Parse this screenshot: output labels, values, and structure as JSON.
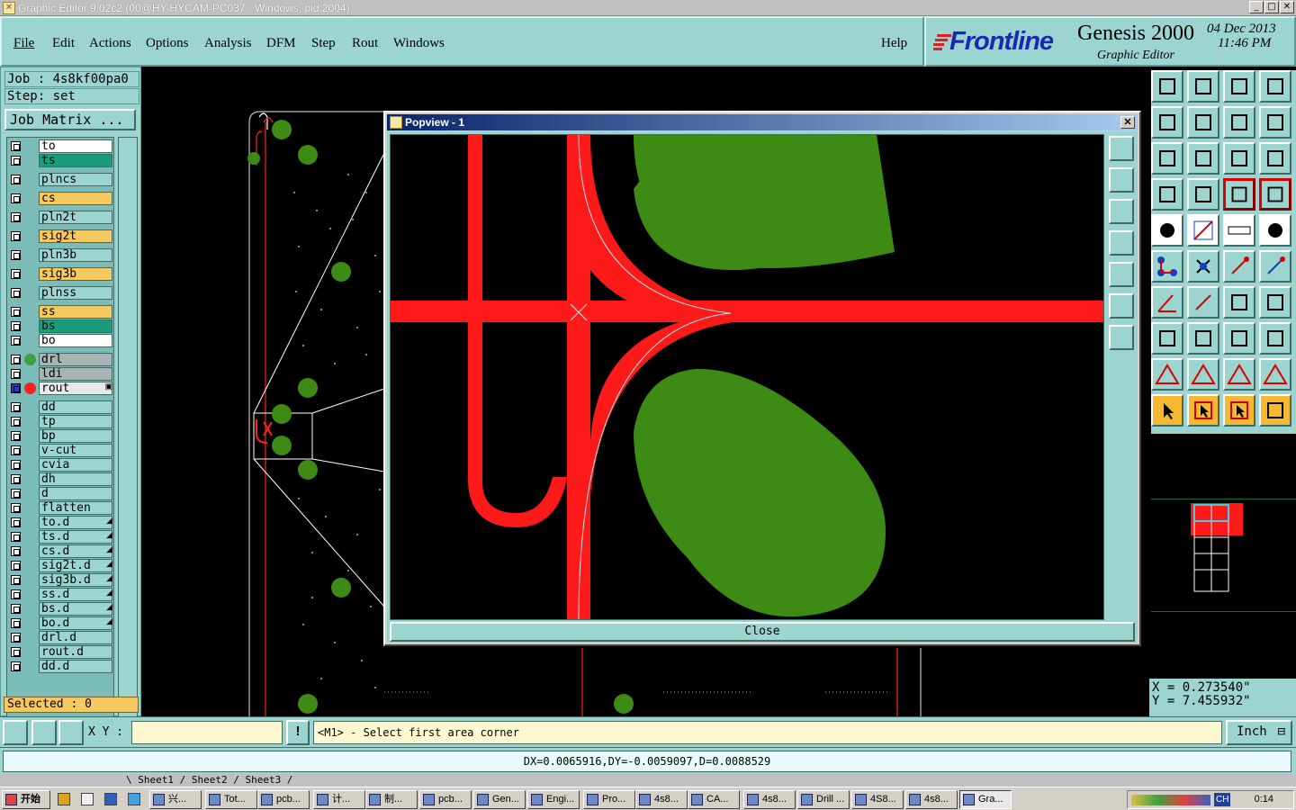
{
  "window": {
    "title": "Graphic Editor 9.02c2 (00@HY-HYCAM-PC037 - Windows, pid:2004)",
    "minimize": "_",
    "maximize": "□",
    "close": "✕"
  },
  "menu": {
    "items": [
      "File",
      "Edit",
      "Actions",
      "Options",
      "Analysis",
      "DFM",
      "Step",
      "Rout",
      "Windows"
    ],
    "help": "Help"
  },
  "brand": {
    "logo": "Frontline",
    "product": "Genesis 2000",
    "subtitle": "Graphic Editor",
    "date": "04 Dec 2013",
    "time": "11:46 PM"
  },
  "job": {
    "job_line": "Job : 4s8kf00pa0",
    "step_line": "Step: set",
    "matrix_button": "Job Matrix ..."
  },
  "layers": [
    {
      "name": "to",
      "color": "#ffffff"
    },
    {
      "name": "ts",
      "color": "#1a9c78"
    },
    {
      "name": "plncs",
      "color": "#9cd4d0"
    },
    {
      "name": "cs",
      "color": "#f5c860"
    },
    {
      "name": "pln2t",
      "color": "#9cd4d0"
    },
    {
      "name": "sig2t",
      "color": "#f5c860"
    },
    {
      "name": "pln3b",
      "color": "#9cd4d0"
    },
    {
      "name": "sig3b",
      "color": "#f5c860"
    },
    {
      "name": "plnss",
      "color": "#9cd4d0"
    },
    {
      "name": "ss",
      "color": "#f5c860"
    },
    {
      "name": "bs",
      "color": "#1a9c78"
    },
    {
      "name": "bo",
      "color": "#ffffff"
    },
    {
      "name": "drl",
      "color": "#a8b4b4",
      "dot": "#40a040"
    },
    {
      "name": "ldi",
      "color": "#a8b4b4"
    },
    {
      "name": "rout",
      "color": "#e8e8e8",
      "dot": "#ff2020",
      "active": true
    },
    {
      "name": "dd",
      "color": "#9cd4d0"
    },
    {
      "name": "tp",
      "color": "#9cd4d0"
    },
    {
      "name": "bp",
      "color": "#9cd4d0"
    },
    {
      "name": "v-cut",
      "color": "#9cd4d0"
    },
    {
      "name": "cvia",
      "color": "#9cd4d0"
    },
    {
      "name": "dh",
      "color": "#9cd4d0"
    },
    {
      "name": "d",
      "color": "#9cd4d0"
    },
    {
      "name": "flatten",
      "color": "#9cd4d0"
    },
    {
      "name": "to.d",
      "color": "#9cd4d0",
      "mark": true
    },
    {
      "name": "ts.d",
      "color": "#9cd4d0",
      "mark": true
    },
    {
      "name": "cs.d",
      "color": "#9cd4d0",
      "mark": true
    },
    {
      "name": "sig2t.d",
      "color": "#9cd4d0",
      "mark": true
    },
    {
      "name": "sig3b.d",
      "color": "#9cd4d0",
      "mark": true
    },
    {
      "name": "ss.d",
      "color": "#9cd4d0",
      "mark": true
    },
    {
      "name": "bs.d",
      "color": "#9cd4d0",
      "mark": true
    },
    {
      "name": "bo.d",
      "color": "#9cd4d0",
      "mark": true
    },
    {
      "name": "drl.d",
      "color": "#9cd4d0"
    },
    {
      "name": "rout.d",
      "color": "#9cd4d0"
    },
    {
      "name": "dd.d",
      "color": "#9cd4d0"
    }
  ],
  "selected": "Selected : 0",
  "popview": {
    "title": "Popview - 1",
    "close_label": "Close",
    "close_x": "✕"
  },
  "coords": {
    "x": "X = 0.273540\"",
    "y": "Y = 7.455932\""
  },
  "bottom": {
    "xy_label": "X Y :",
    "xy_value": "",
    "help_glyph": "!",
    "prompt": "<M1> - Select first area corner",
    "units": "Inch"
  },
  "status": "DX=0.0065916,DY=-0.0059097,D=0.0088529",
  "sheets": "\\ Sheet1 / Sheet2 / Sheet3 /",
  "taskbar": {
    "start": "开始",
    "tasks": [
      "兴...",
      "Tot...",
      "pcb...",
      "计...",
      "制...",
      "pcb...",
      "Gen...",
      "Engi...",
      "Pro...",
      "4s8...",
      "CA...",
      "4s8...",
      "Drill ...",
      "4S8...",
      "4s8...",
      "Gra..."
    ],
    "clock": "0:14",
    "ime": "CH"
  },
  "colors": {
    "teal": "#9cd4d0",
    "trace": "#ff1a1a",
    "pad": "#3d8a14",
    "accent_yellow": "#f5c860"
  }
}
